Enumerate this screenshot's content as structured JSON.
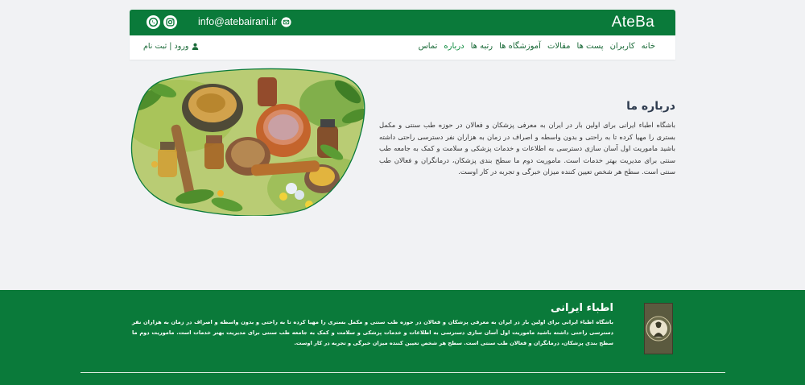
{
  "header": {
    "brand": "AteBa",
    "email": "info@atebairani.ir",
    "social": [
      "instagram-icon",
      "whatsapp-icon"
    ]
  },
  "nav": {
    "items": [
      {
        "label": "خانه"
      },
      {
        "label": "کاربران"
      },
      {
        "label": "پست ها"
      },
      {
        "label": "مقالات"
      },
      {
        "label": "آموزشگاه ها"
      },
      {
        "label": "رتبه ها"
      },
      {
        "label": "درباره"
      },
      {
        "label": "تماس"
      }
    ],
    "active_index": 6,
    "auth_label": "ورود | ثبت نام"
  },
  "about": {
    "title": "درباره ما",
    "text": "باشگاه اطباء ایرانی برای اولین بار در ایران به معرفی پزشکان و فعالان در حوزه طب سنتی و مکمل بستری را مهیا کرده تا به راحتی و بدون واسطه و اصراف در زمان به هزاران نفر دسترسی راحتی داشته باشید ماموریت اول آسان سازی دسترسی به اطلاعات و خدمات پزشکی و سلامت و کمک به جامعه طب سنتی برای مدیریت بهتر خدمات است. ماموریت دوم ما سطح بندی پزشکان، درمانگران و فعالان طب سنتی است. سطح هر شخص تعیین کننده میزان خبرگی و تجربه در کار اوست."
  },
  "footer": {
    "title": "اطباء ایرانی",
    "text": "باشگاه اطباء ایرانی برای اولین بار در ایران به معرفی پزشکان و فعالان در حوزه طب سنتی و مکمل بستری را مهیا کرده تا به راحتی و بدون واسطه و اصراف در زمان به هزاران نفر دسترسی راحتی داشته باشید ماموریت اول آسان سازی دسترسی به اطلاعات و خدمات پزشکی و سلامت و کمک به جامعه طب سنتی برای مدیریت بهتر خدمات است. ماموریت دوم ما سطح بندی پزشکان، درمانگران و فعالان طب سنتی است. سطح هر شخص تعیین کننده میزان خبرگی و تجربه در کار اوست.",
    "logo_text": "Association Of Iranian Physicians"
  },
  "colors": {
    "brand_green": "#0a7a3a",
    "page_bg": "#f1f2f4",
    "nav_text": "#1a6a38",
    "title_text": "#2e3b4e"
  }
}
